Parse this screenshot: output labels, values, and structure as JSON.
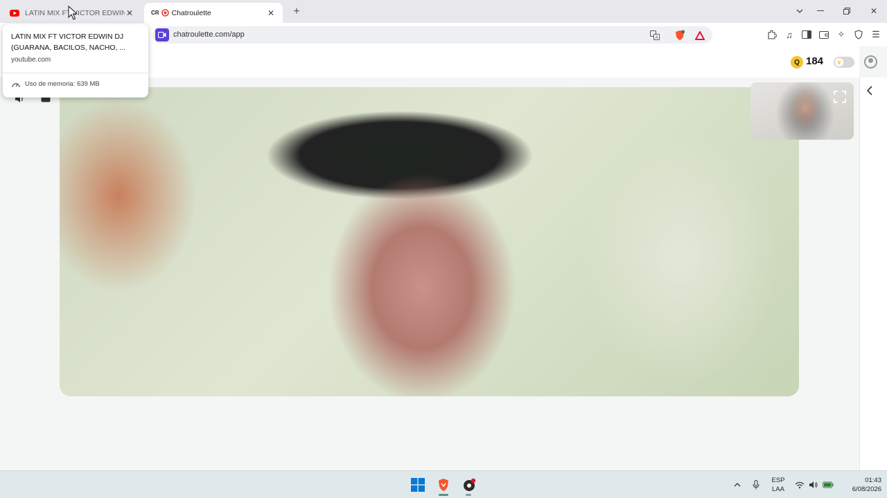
{
  "tabs": [
    {
      "title": "LATIN MIX FT VICTOR EDWIN DJ (GUARANA, BACILOS, NACHO, ...",
      "favicon": "youtube-icon",
      "active": false
    },
    {
      "title": "Chatroulette",
      "favicon": "chatroulette-icon",
      "favicon_text": "CR",
      "active": true
    }
  ],
  "address_bar": {
    "url": "chatroulette.com/app"
  },
  "hover_card": {
    "title": "LATIN MIX FT VICTOR EDWIN DJ (GUARANA, BACILOS, NACHO, ...",
    "domain": "youtube.com",
    "memory": "Uso de memoria: 639 MB"
  },
  "header": {
    "coin_symbol": "Q",
    "coin_count": "184"
  },
  "taskbar": {
    "language_line1": "ESP",
    "language_line2": "LAA",
    "time": "01:43",
    "date": "6/08/2026"
  },
  "colors": {
    "accent": "#5b3fd6",
    "coin": "#f4c430",
    "brave": "#fb542b"
  }
}
